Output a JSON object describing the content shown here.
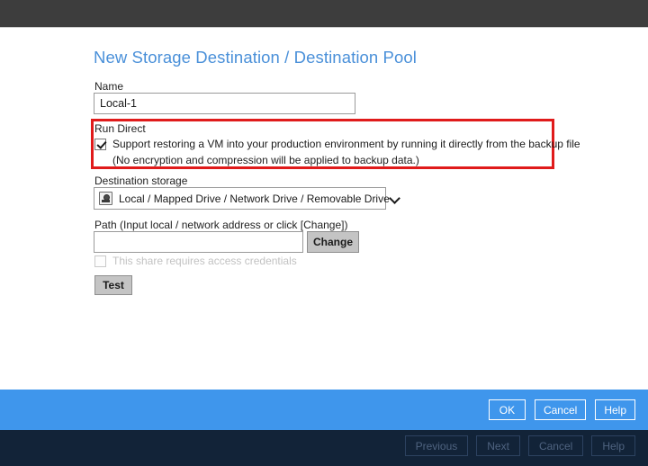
{
  "window": {
    "top_chrome_color": "#3d3d3d"
  },
  "dialog": {
    "title": "New Storage Destination / Destination Pool",
    "title_color": "#4a90d9",
    "name": {
      "label": "Name",
      "value": "Local-1",
      "placeholder": ""
    },
    "run_direct": {
      "label": "Run Direct",
      "highlight_color": "#e01b1b",
      "checkbox_checked": true,
      "checkbox_label": "Support restoring a VM into your production environment by running it directly from the backup file",
      "note": "(No encryption and compression will be applied to backup data.)"
    },
    "destination_storage": {
      "label": "Destination storage",
      "selected": "Local / Mapped Drive / Network Drive / Removable Drive",
      "icon": "drive-icon",
      "chevron": "chevron-down-icon"
    },
    "path": {
      "label": "Path (Input local / network address or click [Change])",
      "value": "",
      "placeholder": "",
      "change_button": "Change"
    },
    "credentials": {
      "label": "This share requires access credentials",
      "checked": false,
      "disabled": true
    },
    "test_button": "Test"
  },
  "action_bar": {
    "background": "#3f96ec",
    "buttons": [
      {
        "label": "OK",
        "name": "ok-button"
      },
      {
        "label": "Cancel",
        "name": "cancel-button"
      },
      {
        "label": "Help",
        "name": "help-button"
      }
    ]
  },
  "wizard_bar": {
    "background": "#122338",
    "buttons": [
      {
        "label": "Previous",
        "name": "previous-button",
        "disabled": true
      },
      {
        "label": "Next",
        "name": "next-button",
        "disabled": true
      },
      {
        "label": "Cancel",
        "name": "wizard-cancel-button",
        "disabled": true
      },
      {
        "label": "Help",
        "name": "wizard-help-button",
        "disabled": true
      }
    ]
  }
}
